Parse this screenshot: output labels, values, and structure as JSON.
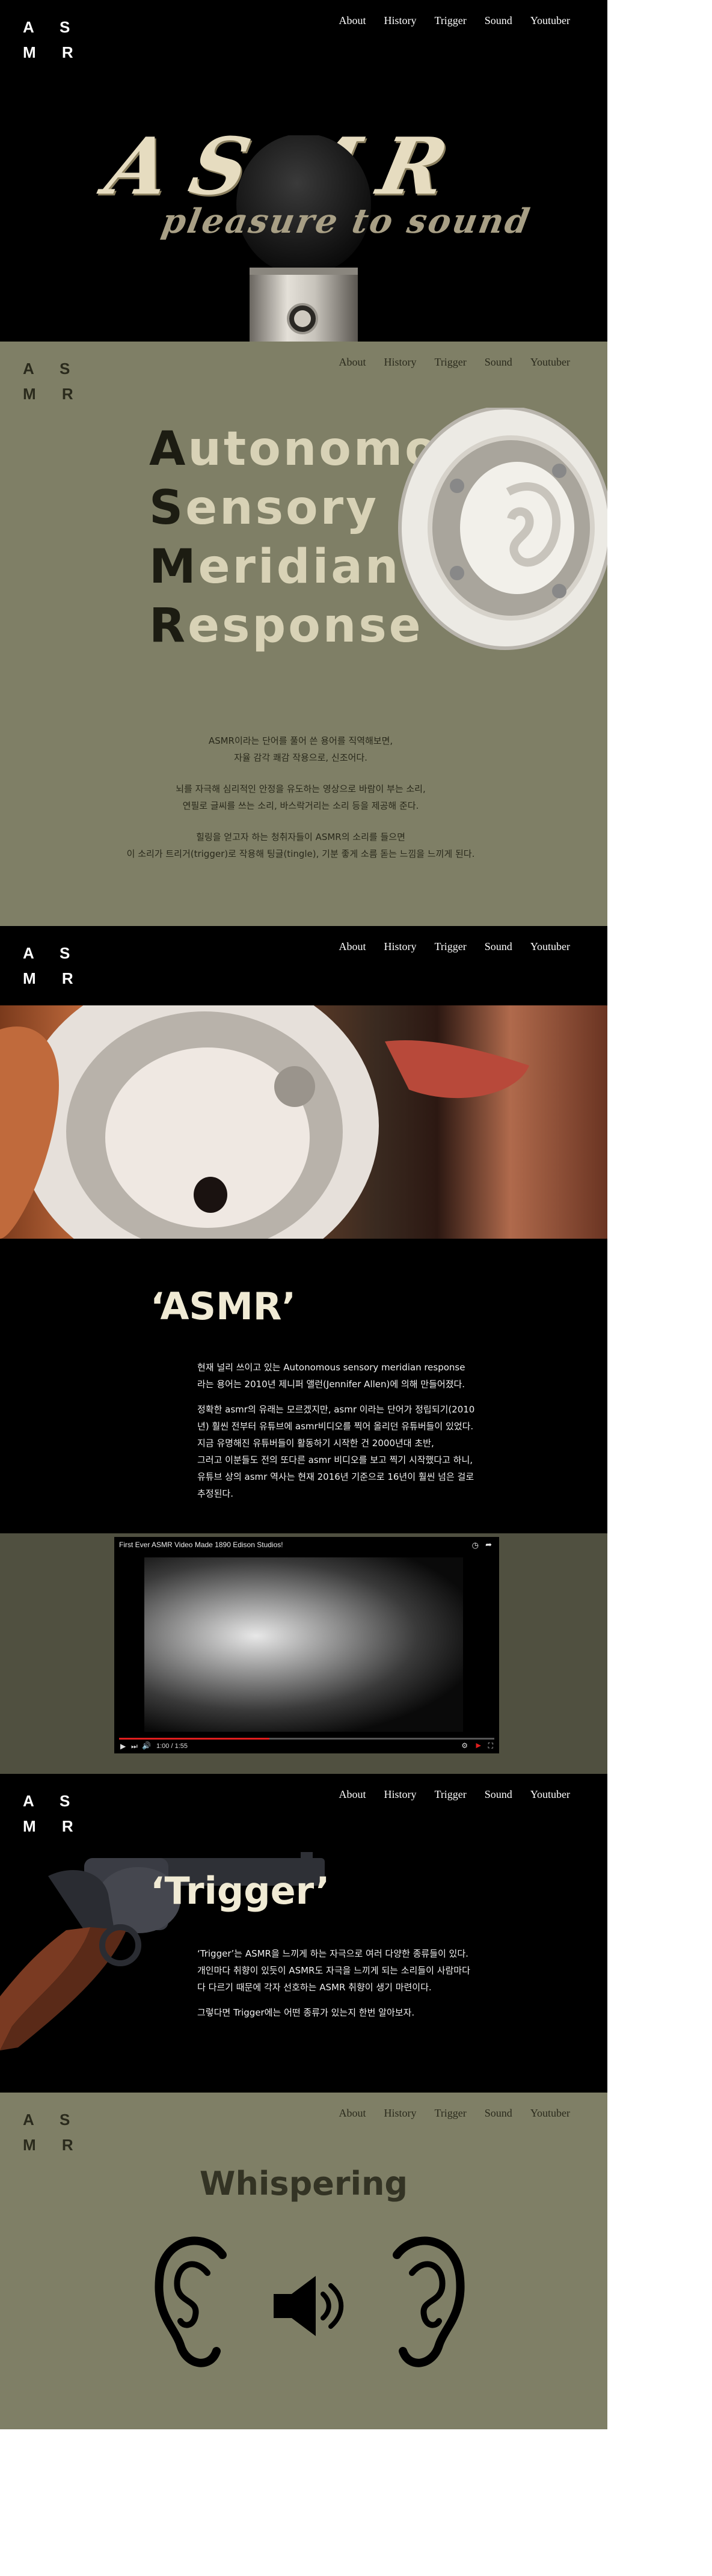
{
  "brand": {
    "logo": "A S\nM R"
  },
  "nav": {
    "about": "About",
    "history": "History",
    "trigger": "Trigger",
    "sound": "Sound",
    "youtuber": "Youtuber"
  },
  "hero": {
    "title": "ASMR",
    "subtitle": "pleasure to sound"
  },
  "definition": {
    "acronym": [
      {
        "first": "A",
        "rest": "utonomous"
      },
      {
        "first": "S",
        "rest": "ensory"
      },
      {
        "first": "M",
        "rest": "eridian"
      },
      {
        "first": "R",
        "rest": "esponse"
      }
    ],
    "p1_l1": "ASMR이라는 단어를 풀어 쓴 용어를 직역해보면,",
    "p1_l2": "자율 감각 쾌감 작용으로, 신조어다.",
    "p2_l1": "뇌를 자극해 심리적인 안정을 유도하는 영상으로 바람이 부는 소리,",
    "p2_l2": "연필로 글씨를 쓰는 소리, 바스락거리는 소리 등을 제공해 준다.",
    "p3_l1": "힐링을 얻고자 하는 청취자들이 ASMR의 소리를 들으면",
    "p3_l2": "이 소리가 트리거(trigger)로 작용해 팅글(tingle), 기분 좋게 소름 돋는 느낌을 느끼게 된다."
  },
  "history": {
    "title": "‘ASMR’",
    "l1": "현재 널리 쓰이고 있는 Autonomous sensory meridian response",
    "l2": "라는 용어는 2010년 제니퍼 앨런(Jennifer Allen)에 의해 만들어졌다.",
    "l3": "정확한 asmr의 유래는 모르겠지만, asmr 이라는 단어가 정립되기(2010",
    "l4": "년) 훨씬 전부터 유튜브에 asmr비디오를 찍어 올리던 유튜버들이 있었다.",
    "l5": "지금 유명해진 유튜버들이 활동하기 시작한 건 2000년대 초반,",
    "l6": "그러고 이분들도 전의 또다른 asmr 비디오를 보고 찍기 시작했다고 하니,",
    "l7": "유튜브 상의 asmr 역사는 현재 2016년 기준으로 16년이 훨씬 넘은 걸로",
    "l8": "추정된다."
  },
  "video": {
    "title": "First Ever ASMR Video Made 1890 Edison Studios!",
    "time": "1:00 / 1:55",
    "progress": 0.4
  },
  "trigger": {
    "title": "‘Trigger’",
    "l1": "‘Trigger’는 ASMR을 느끼게 하는 자극으로 여러 다양한 종류들이 있다.",
    "l2": "개인마다 취향이 있듯이 ASMR도 자극을 느끼게 되는 소리들이 사람마다",
    "l3": "다 다르기 때문에 각자 선호하는 ASMR 취향이 생기 마련이다.",
    "l4": "그렇다면 Trigger에는 어떤 종류가 있는지 한번 알아보자."
  },
  "whispering": {
    "title": "Whispering"
  },
  "colors": {
    "olive": "#7f7f66",
    "black": "#000000",
    "cream": "#e6dcc0"
  }
}
